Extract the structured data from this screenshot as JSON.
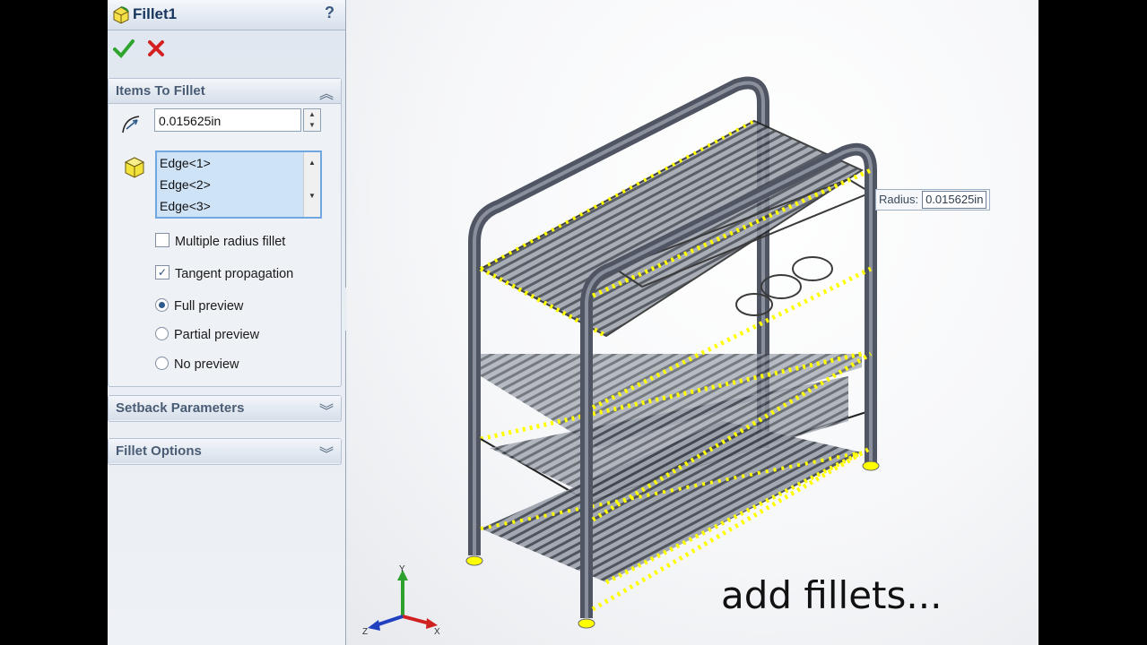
{
  "panel": {
    "title": "Fillet1",
    "help": "?",
    "items_section": {
      "title": "Items To Fillet",
      "toggle": "︽",
      "radius_value": "0.015625in",
      "edges": [
        "Edge<1>",
        "Edge<2>",
        "Edge<3>"
      ]
    },
    "options": {
      "multiple_radius": "Multiple radius fillet",
      "tangent": "Tangent propagation",
      "full_preview": "Full preview",
      "partial_preview": "Partial preview",
      "no_preview": "No preview"
    },
    "setback_section": {
      "title": "Setback Parameters",
      "toggle": "︾"
    },
    "fillet_options_section": {
      "title": "Fillet Options",
      "toggle": "︾"
    }
  },
  "viewport": {
    "radius_label": "Radius:",
    "radius_value": "0.015625in",
    "triad": {
      "x": "X",
      "y": "Y",
      "z": "Z"
    },
    "caption": "add fillets..."
  },
  "colors": {
    "selection_highlight": "#ffff00",
    "frame_tube": "#4f5563",
    "accent": "#17365d"
  }
}
